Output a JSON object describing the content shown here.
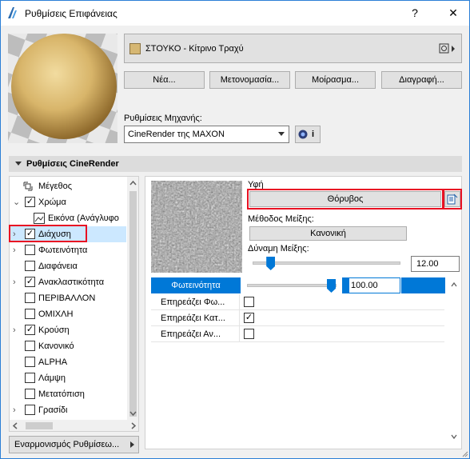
{
  "window": {
    "title": "Ρυθμίσεις Επιφάνειας",
    "help": "?",
    "close": "✕"
  },
  "material": {
    "name": "ΣΤΟΥΚΟ - Κίτρινο Τραχύ",
    "swatch_color": "#d6b773"
  },
  "buttons": {
    "new": "Νέα...",
    "rename": "Μετονομασία...",
    "share": "Μοίρασμα...",
    "delete": "Διαγραφή..."
  },
  "engine": {
    "label": "Ρυθμίσεις Μηχανής:",
    "value": "CineRender της MAXON",
    "info_label": "i"
  },
  "section": {
    "title": "Ρυθμίσεις CineRender"
  },
  "tree": {
    "items": [
      {
        "label": "Μέγεθος",
        "expander": "",
        "checkbox": "none"
      },
      {
        "label": "Χρώμα",
        "expander": "⌄",
        "checkbox": "checked"
      },
      {
        "label": "Εικόνα (Ανάγλυφο",
        "expander": "",
        "checkbox": "image"
      },
      {
        "label": "Διάχυση",
        "expander": "›",
        "checkbox": "checked"
      },
      {
        "label": "Φωτεινότητα",
        "expander": "›",
        "checkbox": "unchecked"
      },
      {
        "label": "Διαφάνεια",
        "expander": "",
        "checkbox": "unchecked"
      },
      {
        "label": "Ανακλαστικότητα",
        "expander": "›",
        "checkbox": "checked"
      },
      {
        "label": "ΠΕΡΙΒΑΛΛΟΝ",
        "expander": "",
        "checkbox": "unchecked"
      },
      {
        "label": "ΟΜΙΧΛΗ",
        "expander": "",
        "checkbox": "unchecked"
      },
      {
        "label": "Κρούση",
        "expander": "›",
        "checkbox": "checked"
      },
      {
        "label": "Κανονικό",
        "expander": "",
        "checkbox": "unchecked"
      },
      {
        "label": "ALPHA",
        "expander": "",
        "checkbox": "unchecked"
      },
      {
        "label": "Λάμψη",
        "expander": "",
        "checkbox": "unchecked"
      },
      {
        "label": "Μετατόπιση",
        "expander": "",
        "checkbox": "unchecked"
      },
      {
        "label": "Γρασίδι",
        "expander": "›",
        "checkbox": "unchecked"
      }
    ],
    "selected_index": 3
  },
  "adapt_button": "Εναρμονισμός Ρυθμίσεω...",
  "texture": {
    "label": "Υφή",
    "value": "Θόρυβος",
    "blend_label": "Μέθοδος Μείξης:",
    "blend_value": "Κανονική",
    "strength_label": "Δύναμη Μείξης:",
    "strength_value": "12.00",
    "strength_level": 12
  },
  "brightness": {
    "label": "Φωτεινότητα",
    "value": "100.00",
    "level": 100
  },
  "properties": [
    {
      "label": "Επηρεάζει Φω...",
      "checked": false
    },
    {
      "label": "Επηρεάζει Κατ...",
      "checked": true
    },
    {
      "label": "Επηρεάζει Αν...",
      "checked": false
    }
  ],
  "colors": {
    "accent": "#0078d7",
    "highlight_border": "#e81123",
    "selection": "#cce8ff"
  }
}
